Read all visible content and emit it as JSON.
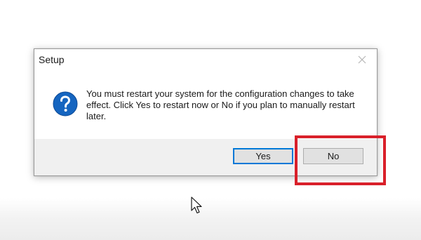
{
  "dialog": {
    "title": "Setup",
    "close_icon": "close-icon",
    "icon": "question-icon",
    "message": "You must restart your system for the configuration changes to take effect. Click Yes to restart now or No if you plan to manually restart later.",
    "buttons": {
      "yes_label": "Yes",
      "no_label": "No"
    }
  },
  "annotation": {
    "highlight_color": "#d9202a",
    "highlighted": "No"
  },
  "colors": {
    "focus_border": "#0078d7",
    "icon_blue": "#1565c0"
  }
}
